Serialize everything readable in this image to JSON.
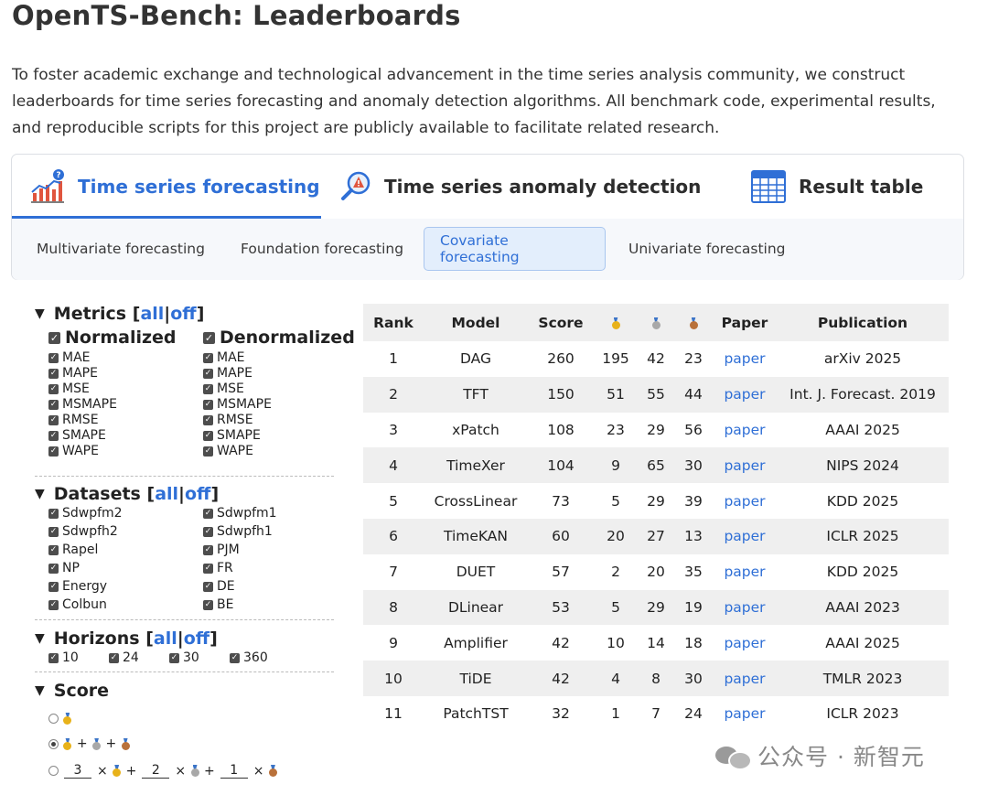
{
  "page": {
    "title": "OpenTS-Bench: Leaderboards",
    "intro": "To foster academic exchange and technological advancement in the time series analysis community, we construct leaderboards for time series forecasting and anomaly detection algorithms. All benchmark code, experimental results, and reproducible scripts for this project are publicly available to facilitate related research."
  },
  "main_tabs": [
    {
      "label": "Time series forecasting",
      "icon": "bar-chart-icon",
      "active": true
    },
    {
      "label": "Time series anomaly detection",
      "icon": "magnifier-alert-icon",
      "active": false
    },
    {
      "label": "Result table",
      "icon": "table-icon",
      "active": false
    }
  ],
  "sub_tabs": [
    {
      "label": "Multivariate forecasting",
      "active": false
    },
    {
      "label": "Foundation forecasting",
      "active": false
    },
    {
      "label": "Covariate forecasting",
      "active": true
    },
    {
      "label": "Univariate forecasting",
      "active": false
    }
  ],
  "sidebar": {
    "all_label": "all",
    "off_label": "off",
    "separator": "|",
    "metrics": {
      "title": "Metrics",
      "normalized": {
        "label": "Normalized",
        "items": [
          "MAE",
          "MAPE",
          "MSE",
          "MSMAPE",
          "RMSE",
          "SMAPE",
          "WAPE"
        ]
      },
      "denormalized": {
        "label": "Denormalized",
        "items": [
          "MAE",
          "MAPE",
          "MSE",
          "MSMAPE",
          "RMSE",
          "SMAPE",
          "WAPE"
        ]
      }
    },
    "datasets": {
      "title": "Datasets",
      "left": [
        "Sdwpfm2",
        "Sdwpfh2",
        "Rapel",
        "NP",
        "Energy",
        "Colbun"
      ],
      "right": [
        "Sdwpfm1",
        "Sdwpfh1",
        "PJM",
        "FR",
        "DE",
        "BE"
      ]
    },
    "horizons": {
      "title": "Horizons",
      "items": [
        "10",
        "24",
        "30",
        "360"
      ]
    },
    "score": {
      "title": "Score",
      "selected_option": 2,
      "weights": [
        "3",
        "2",
        "1"
      ],
      "plus": "+",
      "times": "×"
    }
  },
  "table": {
    "headers": {
      "rank": "Rank",
      "model": "Model",
      "score": "Score",
      "gold": "gold-medal-icon",
      "silver": "silver-medal-icon",
      "bronze": "bronze-medal-icon",
      "paper": "Paper",
      "publication": "Publication"
    },
    "rows": [
      {
        "rank": "1",
        "model": "DAG",
        "score": "260",
        "gold": "195",
        "silver": "42",
        "bronze": "23",
        "paper": "paper",
        "publication": "arXiv 2025"
      },
      {
        "rank": "2",
        "model": "TFT",
        "score": "150",
        "gold": "51",
        "silver": "55",
        "bronze": "44",
        "paper": "paper",
        "publication": "Int. J. Forecast. 2019"
      },
      {
        "rank": "3",
        "model": "xPatch",
        "score": "108",
        "gold": "23",
        "silver": "29",
        "bronze": "56",
        "paper": "paper",
        "publication": "AAAI 2025"
      },
      {
        "rank": "4",
        "model": "TimeXer",
        "score": "104",
        "gold": "9",
        "silver": "65",
        "bronze": "30",
        "paper": "paper",
        "publication": "NIPS 2024"
      },
      {
        "rank": "5",
        "model": "CrossLinear",
        "score": "73",
        "gold": "5",
        "silver": "29",
        "bronze": "39",
        "paper": "paper",
        "publication": "KDD 2025"
      },
      {
        "rank": "6",
        "model": "TimeKAN",
        "score": "60",
        "gold": "20",
        "silver": "27",
        "bronze": "13",
        "paper": "paper",
        "publication": "ICLR 2025"
      },
      {
        "rank": "7",
        "model": "DUET",
        "score": "57",
        "gold": "2",
        "silver": "20",
        "bronze": "35",
        "paper": "paper",
        "publication": "KDD 2025"
      },
      {
        "rank": "8",
        "model": "DLinear",
        "score": "53",
        "gold": "5",
        "silver": "29",
        "bronze": "19",
        "paper": "paper",
        "publication": "AAAI 2023"
      },
      {
        "rank": "9",
        "model": "Amplifier",
        "score": "42",
        "gold": "10",
        "silver": "14",
        "bronze": "18",
        "paper": "paper",
        "publication": "AAAI 2025"
      },
      {
        "rank": "10",
        "model": "TiDE",
        "score": "42",
        "gold": "4",
        "silver": "8",
        "bronze": "30",
        "paper": "paper",
        "publication": "TMLR 2023"
      },
      {
        "rank": "11",
        "model": "PatchTST",
        "score": "32",
        "gold": "1",
        "silver": "7",
        "bronze": "24",
        "paper": "paper",
        "publication": "ICLR 2023"
      }
    ]
  },
  "watermark": {
    "text": "公众号 · 新智元"
  },
  "colors": {
    "accent": "#2f6fd6",
    "stripe": "#efefef",
    "active_sub_tab_bg": "#e3eefc"
  }
}
